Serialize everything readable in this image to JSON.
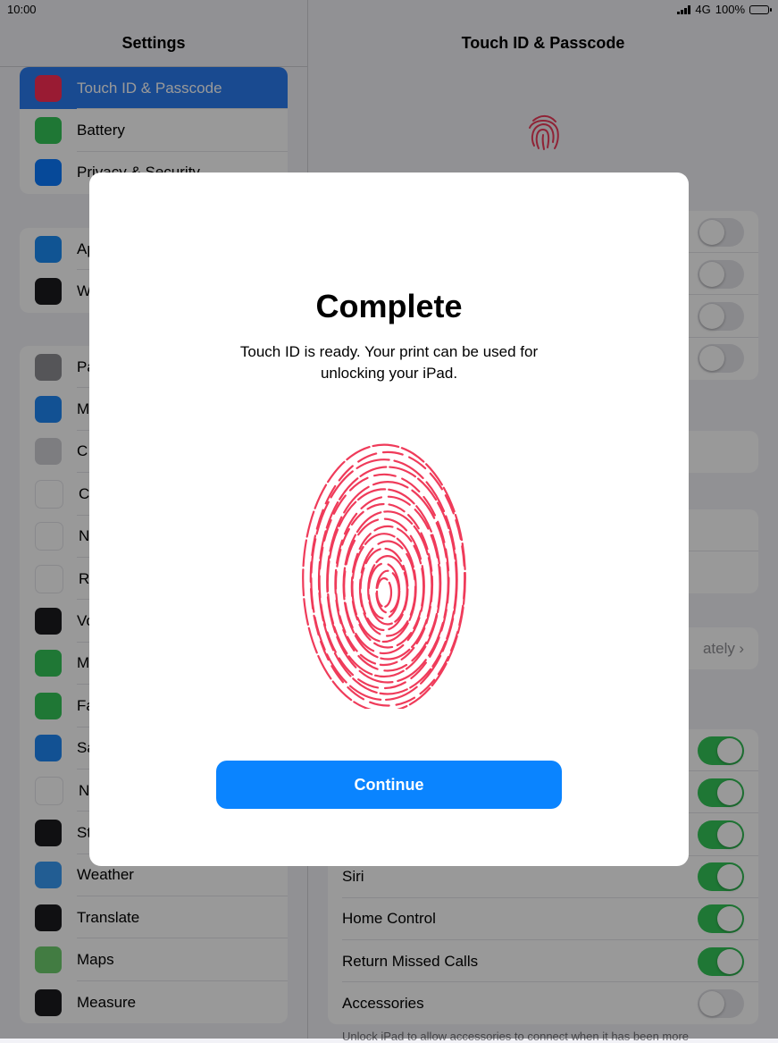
{
  "status": {
    "time": "10:00",
    "network": "4G",
    "battery": "100%"
  },
  "left": {
    "title": "Settings",
    "groups": [
      {
        "items": [
          {
            "label": "Touch ID & Passcode",
            "icon": "fingerprint-icon",
            "color": "#ff2d55",
            "selected": true
          },
          {
            "label": "Battery",
            "icon": "battery-icon",
            "color": "#34c759"
          },
          {
            "label": "Privacy & Security",
            "icon": "hand-icon",
            "color": "#0a7aff"
          }
        ]
      },
      {
        "items": [
          {
            "label": "Ap",
            "icon": "app-store-icon",
            "color": "#1b8cf6"
          },
          {
            "label": "W",
            "icon": "wallet-icon",
            "color": "#1c1c1e"
          }
        ]
      },
      {
        "items": [
          {
            "label": "Pa",
            "icon": "key-icon",
            "color": "#8e8e93"
          },
          {
            "label": "M",
            "icon": "mail-icon",
            "color": "#1e88f5"
          },
          {
            "label": "C",
            "icon": "contacts-icon",
            "color": "#d1d1d6"
          },
          {
            "label": "C",
            "icon": "calendar-icon",
            "color": "#ffffff"
          },
          {
            "label": "N",
            "icon": "notes-icon",
            "color": "#ffffff"
          },
          {
            "label": "Re",
            "icon": "reminders-icon",
            "color": "#ffffff"
          },
          {
            "label": "Vo",
            "icon": "voice-memos-icon",
            "color": "#1c1c1e"
          },
          {
            "label": "M",
            "icon": "messages-icon",
            "color": "#34c759"
          },
          {
            "label": "Fa",
            "icon": "facetime-icon",
            "color": "#34c759"
          },
          {
            "label": "Sa",
            "icon": "safari-icon",
            "color": "#1e88f5"
          },
          {
            "label": "N",
            "icon": "news-icon",
            "color": "#ffffff"
          },
          {
            "label": "St",
            "icon": "stocks-icon",
            "color": "#1c1c1e"
          },
          {
            "label": "Weather",
            "icon": "weather-icon",
            "color": "#3a9cf5"
          },
          {
            "label": "Translate",
            "icon": "translate-icon",
            "color": "#1c1c1e"
          },
          {
            "label": "Maps",
            "icon": "maps-icon",
            "color": "#6fcf6f"
          },
          {
            "label": "Measure",
            "icon": "measure-icon",
            "color": "#1c1c1e"
          }
        ]
      }
    ]
  },
  "right": {
    "title": "Touch ID & Passcode",
    "rows_group_a": [
      "",
      "",
      "",
      ""
    ],
    "rows_group_b": [
      ""
    ],
    "rows_group_c": [
      "",
      ""
    ],
    "require_value": "ately",
    "allow_rows": [
      {
        "label": "",
        "on": true
      },
      {
        "label": "",
        "on": true
      },
      {
        "label": "",
        "on": true
      },
      {
        "label": "Siri",
        "on": true
      },
      {
        "label": "Home Control",
        "on": true
      },
      {
        "label": "Return Missed Calls",
        "on": true
      },
      {
        "label": "Accessories",
        "on": false
      }
    ],
    "footnote": "Unlock iPad to allow accessories to connect when it has been more"
  },
  "modal": {
    "title": "Complete",
    "message": "Touch ID is ready. Your print can be used for unlocking your iPad.",
    "button": "Continue",
    "accent": "#0a84ff",
    "fingerprint_color": "#ef3b5a"
  }
}
